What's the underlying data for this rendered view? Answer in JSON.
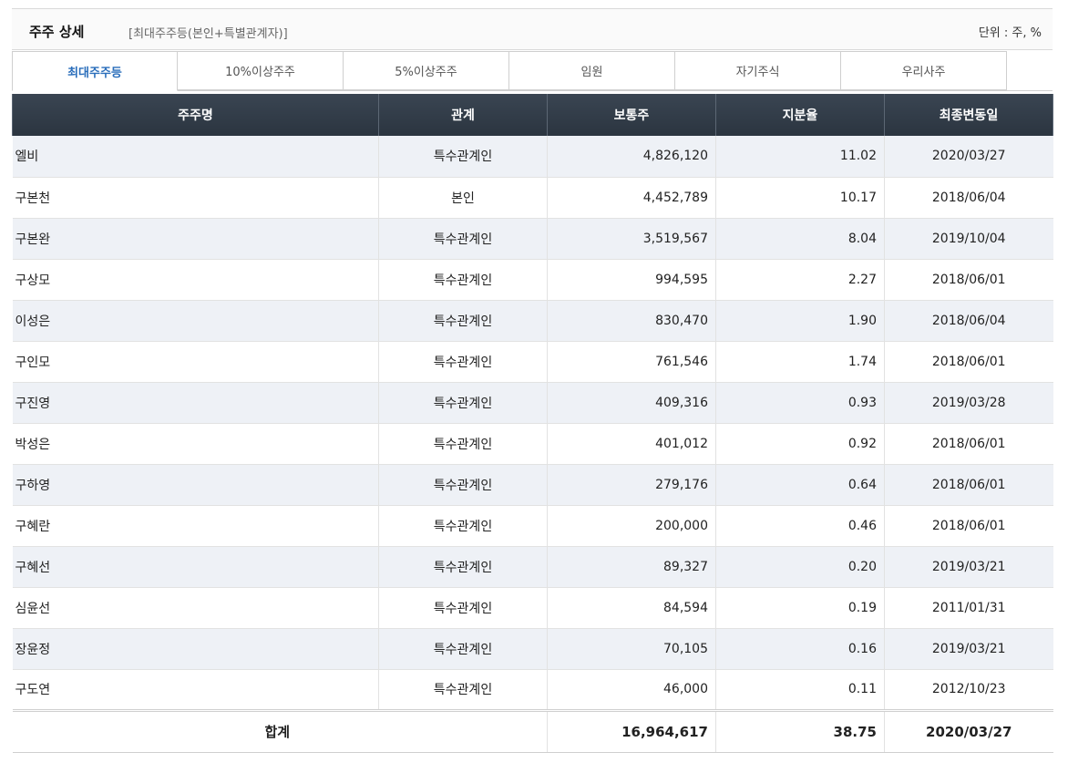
{
  "header": {
    "title": "주주 상세",
    "subtitle": "[최대주주등(본인+특별관계자)]",
    "unit": "단위 : 주, %"
  },
  "tabs": [
    {
      "label": "최대주주등",
      "active": true
    },
    {
      "label": "10%이상주주",
      "active": false
    },
    {
      "label": "5%이상주주",
      "active": false
    },
    {
      "label": "임원",
      "active": false
    },
    {
      "label": "자기주식",
      "active": false
    },
    {
      "label": "우리사주",
      "active": false
    }
  ],
  "table": {
    "columns": [
      "주주명",
      "관계",
      "보통주",
      "지분율",
      "최종변동일"
    ],
    "rows": [
      {
        "name": "엘비",
        "relation": "특수관계인",
        "shares": "4,826,120",
        "ratio": "11.02",
        "date": "2020/03/27"
      },
      {
        "name": "구본천",
        "relation": "본인",
        "shares": "4,452,789",
        "ratio": "10.17",
        "date": "2018/06/04"
      },
      {
        "name": "구본완",
        "relation": "특수관계인",
        "shares": "3,519,567",
        "ratio": "8.04",
        "date": "2019/10/04"
      },
      {
        "name": "구상모",
        "relation": "특수관계인",
        "shares": "994,595",
        "ratio": "2.27",
        "date": "2018/06/01"
      },
      {
        "name": "이성은",
        "relation": "특수관계인",
        "shares": "830,470",
        "ratio": "1.90",
        "date": "2018/06/04"
      },
      {
        "name": "구인모",
        "relation": "특수관계인",
        "shares": "761,546",
        "ratio": "1.74",
        "date": "2018/06/01"
      },
      {
        "name": "구진영",
        "relation": "특수관계인",
        "shares": "409,316",
        "ratio": "0.93",
        "date": "2019/03/28"
      },
      {
        "name": "박성은",
        "relation": "특수관계인",
        "shares": "401,012",
        "ratio": "0.92",
        "date": "2018/06/01"
      },
      {
        "name": "구하영",
        "relation": "특수관계인",
        "shares": "279,176",
        "ratio": "0.64",
        "date": "2018/06/01"
      },
      {
        "name": "구혜란",
        "relation": "특수관계인",
        "shares": "200,000",
        "ratio": "0.46",
        "date": "2018/06/01"
      },
      {
        "name": "구혜선",
        "relation": "특수관계인",
        "shares": "89,327",
        "ratio": "0.20",
        "date": "2019/03/21"
      },
      {
        "name": "심윤선",
        "relation": "특수관계인",
        "shares": "84,594",
        "ratio": "0.19",
        "date": "2011/01/31"
      },
      {
        "name": "장윤정",
        "relation": "특수관계인",
        "shares": "70,105",
        "ratio": "0.16",
        "date": "2019/03/21"
      },
      {
        "name": "구도연",
        "relation": "특수관계인",
        "shares": "46,000",
        "ratio": "0.11",
        "date": "2012/10/23"
      }
    ],
    "total": {
      "label": "합계",
      "shares": "16,964,617",
      "ratio": "38.75",
      "date": "2020/03/27"
    }
  },
  "colors": {
    "active_tab": "#2a6ebb",
    "header_bg": "#2b3540",
    "row_alt": "#eef1f6"
  }
}
